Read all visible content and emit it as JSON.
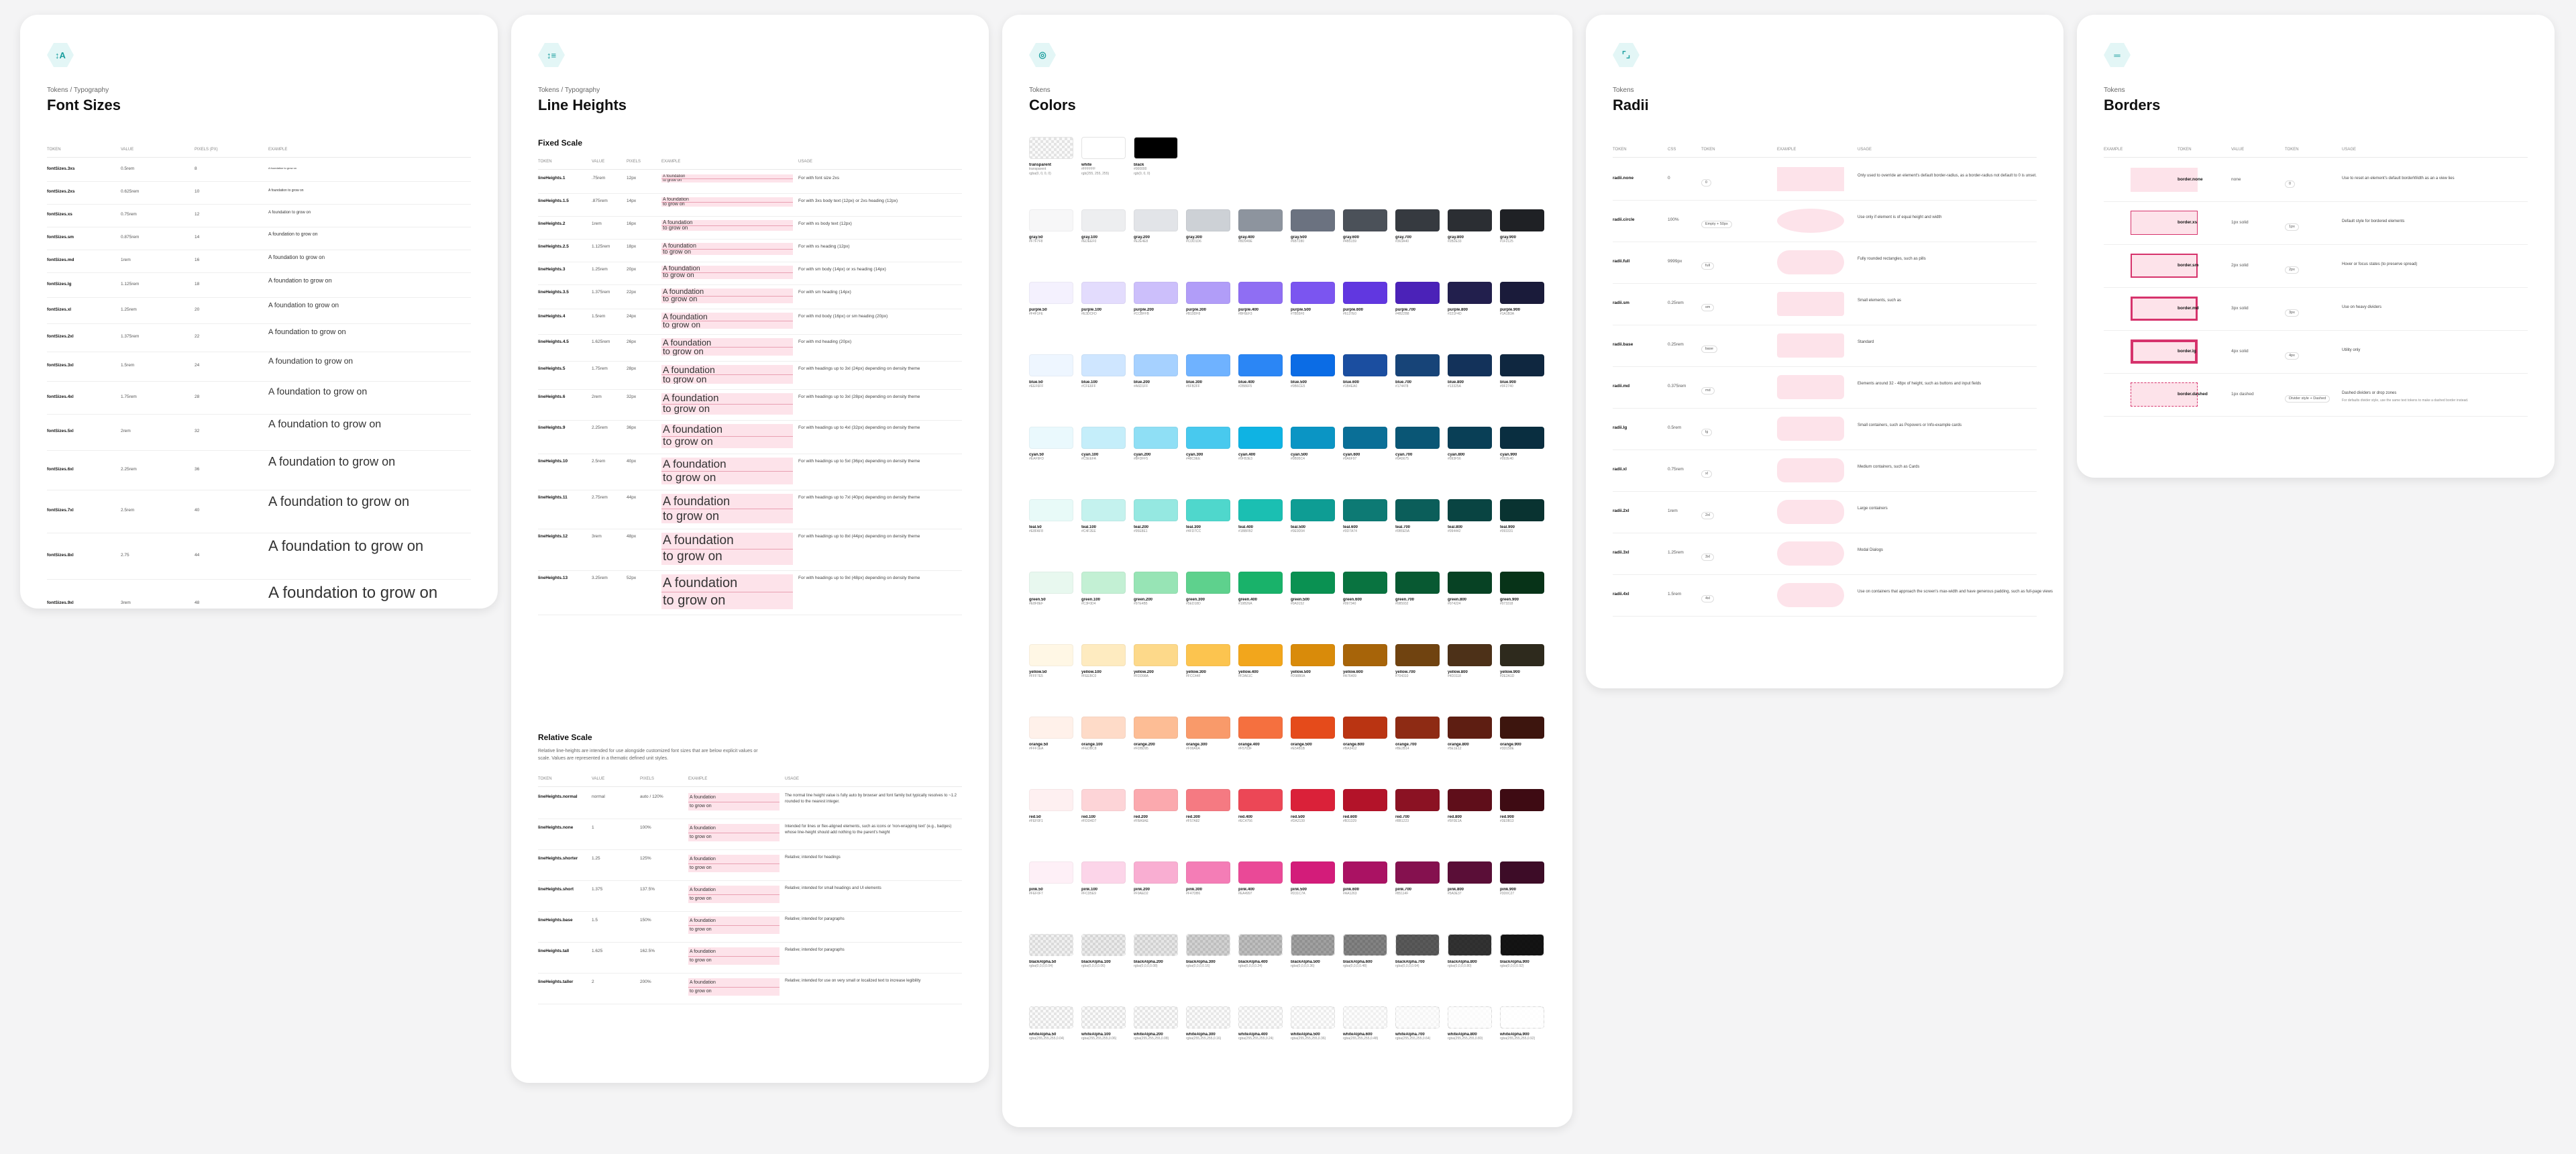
{
  "font_sizes": {
    "icon": "font-size-icon",
    "breadcrumb": "Tokens / Typography",
    "title": "Font Sizes",
    "headers": [
      "TOKEN",
      "VALUE",
      "PIXELS (PX)",
      "EXAMPLE"
    ],
    "example_text": "A foundation to grow on",
    "rows": [
      {
        "token": "fontSizes.3xs",
        "value": "0.5rem",
        "px": "8",
        "size": 8
      },
      {
        "token": "fontSizes.2xs",
        "value": "0.625rem",
        "px": "10",
        "size": 10
      },
      {
        "token": "fontSizes.xs",
        "value": "0.75rem",
        "px": "12",
        "size": 12
      },
      {
        "token": "fontSizes.sm",
        "value": "0.875rem",
        "px": "14",
        "size": 14
      },
      {
        "token": "fontSizes.md",
        "value": "1rem",
        "px": "16",
        "size": 16
      },
      {
        "token": "fontSizes.lg",
        "value": "1.125rem",
        "px": "18",
        "size": 18
      },
      {
        "token": "fontSizes.xl",
        "value": "1.25rem",
        "px": "20",
        "size": 20
      },
      {
        "token": "fontSizes.2xl",
        "value": "1.375rem",
        "px": "22",
        "size": 22
      },
      {
        "token": "fontSizes.3xl",
        "value": "1.5rem",
        "px": "24",
        "size": 24
      },
      {
        "token": "fontSizes.4xl",
        "value": "1.75rem",
        "px": "28",
        "size": 28
      },
      {
        "token": "fontSizes.5xl",
        "value": "2rem",
        "px": "32",
        "size": 32
      },
      {
        "token": "fontSizes.6xl",
        "value": "2.25rem",
        "px": "36",
        "size": 36
      },
      {
        "token": "fontSizes.7xl",
        "value": "2.5rem",
        "px": "40",
        "size": 40
      },
      {
        "token": "fontSizes.8xl",
        "value": "2.75",
        "px": "44",
        "size": 44
      },
      {
        "token": "fontSizes.9xl",
        "value": "3rem",
        "px": "48",
        "size": 48
      }
    ]
  },
  "line_heights": {
    "icon": "line-height-icon",
    "breadcrumb": "Tokens / Typography",
    "title": "Line Heights",
    "fixed_heading": "Fixed Scale",
    "headers": [
      "TOKEN",
      "VALUE",
      "PIXELS",
      "EXAMPLE",
      "USAGE"
    ],
    "example_line1": "A foundation",
    "example_line2": "to grow on",
    "fixed_rows": [
      {
        "token": "lineHeights.1",
        "value": ".75rem",
        "px": "12px",
        "fs": 6,
        "lh": 12,
        "usage": "For with font size 2xs"
      },
      {
        "token": "lineHeights.1.5",
        "value": ".875rem",
        "px": "14px",
        "fs": 7,
        "lh": 14,
        "usage": "For with 3xs body text (12px) or 2xs heading (12px)"
      },
      {
        "token": "lineHeights.2",
        "value": "1rem",
        "px": "16px",
        "fs": 8,
        "lh": 16,
        "usage": "For with xs body text (12px)"
      },
      {
        "token": "lineHeights.2.5",
        "value": "1.125rem",
        "px": "18px",
        "fs": 9,
        "lh": 18,
        "usage": "For with xs heading (12px)"
      },
      {
        "token": "lineHeights.3",
        "value": "1.25rem",
        "px": "20px",
        "fs": 10,
        "lh": 20,
        "usage": "For with sm body (14px) or xs heading (14px)"
      },
      {
        "token": "lineHeights.3.5",
        "value": "1.375rem",
        "px": "22px",
        "fs": 11,
        "lh": 22,
        "usage": "For with sm heading (14px)"
      },
      {
        "token": "lineHeights.4",
        "value": "1.5rem",
        "px": "24px",
        "fs": 12,
        "lh": 24,
        "usage": "For with md body (16px) or sm heading (20px)"
      },
      {
        "token": "lineHeights.4.5",
        "value": "1.625rem",
        "px": "26px",
        "fs": 13,
        "lh": 26,
        "usage": "For with md heading (20px)"
      },
      {
        "token": "lineHeights.5",
        "value": "1.75rem",
        "px": "28px",
        "fs": 14,
        "lh": 28,
        "usage": "For with headings up to 3xl (24px) depending on density theme"
      },
      {
        "token": "lineHeights.6",
        "value": "2rem",
        "px": "32px",
        "fs": 15,
        "lh": 32,
        "usage": "For with headings up to 3xl (28px) depending on density theme"
      },
      {
        "token": "lineHeights.9",
        "value": "2.25rem",
        "px": "36px",
        "fs": 16,
        "lh": 36,
        "usage": "For with headings up to 4xl (32px) depending on density theme"
      },
      {
        "token": "lineHeights.10",
        "value": "2.5rem",
        "px": "40px",
        "fs": 17,
        "lh": 40,
        "usage": "For with headings up to 5xl (36px) depending on density theme"
      },
      {
        "token": "lineHeights.11",
        "value": "2.75rem",
        "px": "44px",
        "fs": 18,
        "lh": 44,
        "usage": "For with headings up to 7xl (40px) depending on density theme"
      },
      {
        "token": "lineHeights.12",
        "value": "3rem",
        "px": "48px",
        "fs": 19,
        "lh": 48,
        "usage": "For with headings up to 8xl (44px) depending on density theme"
      },
      {
        "token": "lineHeights.13",
        "value": "3.25rem",
        "px": "52px",
        "fs": 20,
        "lh": 52,
        "usage": "For with headings up to 9xl (48px) depending on density theme"
      }
    ],
    "relative_heading": "Relative Scale",
    "relative_desc": "Relative line-heights are intended for use alongside customized font sizes that are below explicit values or scale. Values are represented in a thematic defined unit styles.",
    "relative_rows": [
      {
        "token": "lineHeights.normal",
        "value": "normal",
        "px": "auto / 120%",
        "usage": "The normal line height value is fully auto by browser and font family but typically resolves to ~1.2 rounded to the nearest integer."
      },
      {
        "token": "lineHeights.none",
        "value": "1",
        "px": "100%",
        "usage": "Intended for lines or flex-aligned elements, such as icons or 'non-wrapping text' (e.g., badges) whose line-height should add nothing to the parent's height"
      },
      {
        "token": "lineHeights.shorter",
        "value": "1.25",
        "px": "125%",
        "usage": "Relative; intended for headings"
      },
      {
        "token": "lineHeights.short",
        "value": "1.375",
        "px": "137.5%",
        "usage": "Relative; intended for small headings and UI elements"
      },
      {
        "token": "lineHeights.base",
        "value": "1.5",
        "px": "150%",
        "usage": "Relative; intended for paragraphs"
      },
      {
        "token": "lineHeights.tall",
        "value": "1.625",
        "px": "162.5%",
        "usage": "Relative; intended for paragraphs"
      },
      {
        "token": "lineHeights.taller",
        "value": "2",
        "px": "200%",
        "usage": "Relative; intended for use on very small or localized text to increase legibility"
      }
    ]
  },
  "colors": {
    "icon": "palette-icon",
    "breadcrumb": "Tokens",
    "title": "Colors",
    "special": [
      {
        "name": "transparent",
        "sub": "transparent",
        "sub2": "rgba(0, 0, 0, 0)",
        "color": "transparent"
      },
      {
        "name": "white",
        "sub": "#FFFFFF",
        "sub2": "rgb(255, 255, 255)",
        "color": "#FFFFFF"
      },
      {
        "name": "black",
        "sub": "#000000",
        "sub2": "rgb(0, 0, 0)",
        "color": "#000000"
      }
    ],
    "palettes": [
      {
        "name": "gray",
        "colors": [
          "#F7F7F8",
          "#EDEEF0",
          "#E2E4E8",
          "#CDD1D6",
          "#8D949E",
          "#6B7280",
          "#4B5159",
          "#363A40",
          "#2B2E33",
          "#1F2125"
        ]
      },
      {
        "name": "purple",
        "colors": [
          "#F4F1FE",
          "#E3DCFD",
          "#CCBFFB",
          "#B19DF8",
          "#8F6EF3",
          "#7B55F0",
          "#6137E0",
          "#4B22B8",
          "#221F4D",
          "#1A1B3A"
        ]
      },
      {
        "name": "blue",
        "colors": [
          "#EEF6FF",
          "#CFE6FF",
          "#A6D1FF",
          "#6FB2FF",
          "#2B86F5",
          "#0B6CE5",
          "#1B4EA0",
          "#174478",
          "#13325A",
          "#0F2740"
        ]
      },
      {
        "name": "cyan",
        "colors": [
          "#EAF9FD",
          "#C5EEFA",
          "#8FDFF5",
          "#48C9EE",
          "#0FB3E3",
          "#0B95C4",
          "#0A6F97",
          "#0A5675",
          "#093F56",
          "#092E40"
        ]
      },
      {
        "name": "teal",
        "colors": [
          "#E8FAF8",
          "#C4F2EE",
          "#95E8E1",
          "#4FD7CC",
          "#1BBFB2",
          "#0E9D94",
          "#0D7A74",
          "#0B5E5A",
          "#094442",
          "#093331"
        ]
      },
      {
        "name": "green",
        "colors": [
          "#E8F8EF",
          "#C3F0D4",
          "#97E4B5",
          "#5ED18D",
          "#19B26A",
          "#0A9152",
          "#097340",
          "#085932",
          "#074224",
          "#073318"
        ]
      },
      {
        "name": "yellow",
        "colors": [
          "#FFF7E5",
          "#FEEBC0",
          "#FDD98A",
          "#FCC44F",
          "#F2A61C",
          "#D98B0A",
          "#A76409",
          "#704310",
          "#4D3118",
          "#2E2A1D"
        ]
      },
      {
        "name": "orange",
        "colors": [
          "#FFF1EA",
          "#FEDBC8",
          "#FDBD95",
          "#F99A6A",
          "#F5703F",
          "#E54B1B",
          "#BA3412",
          "#8E2B14",
          "#5E1E12",
          "#3D150E"
        ]
      },
      {
        "name": "red",
        "colors": [
          "#FEF0F1",
          "#FDD4D7",
          "#FBA9AE",
          "#F57A82",
          "#EC4756",
          "#DA2139",
          "#B31329",
          "#8B1223",
          "#5F0E1A",
          "#3E0B13"
        ]
      },
      {
        "name": "pink",
        "colors": [
          "#FEF0F7",
          "#FCD5E9",
          "#F9AED2",
          "#F47DB6",
          "#EA4997",
          "#D31C7A",
          "#AA1263",
          "#85114F",
          "#5A0E37",
          "#3D0C27"
        ]
      },
      {
        "name": "blackAlpha",
        "colors": [
          "rgba(0,0,0,0.04)",
          "rgba(0,0,0,0.06)",
          "rgba(0,0,0,0.08)",
          "rgba(0,0,0,0.16)",
          "rgba(0,0,0,0.24)",
          "rgba(0,0,0,0.36)",
          "rgba(0,0,0,0.48)",
          "rgba(0,0,0,0.64)",
          "rgba(0,0,0,0.80)",
          "rgba(0,0,0,0.92)"
        ]
      },
      {
        "name": "whiteAlpha",
        "colors": [
          "rgba(255,255,255,0.04)",
          "rgba(255,255,255,0.06)",
          "rgba(255,255,255,0.08)",
          "rgba(255,255,255,0.16)",
          "rgba(255,255,255,0.24)",
          "rgba(255,255,255,0.36)",
          "rgba(255,255,255,0.48)",
          "rgba(255,255,255,0.64)",
          "rgba(255,255,255,0.80)",
          "rgba(255,255,255,0.92)"
        ]
      }
    ],
    "steps": [
      "50",
      "100",
      "200",
      "300",
      "400",
      "500",
      "600",
      "700",
      "800",
      "900"
    ]
  },
  "radii": {
    "icon": "radius-icon",
    "breadcrumb": "Tokens",
    "title": "Radii",
    "headers": [
      "TOKEN",
      "CSS",
      "TOKEN",
      "EXAMPLE",
      "USAGE"
    ],
    "rows": [
      {
        "token": "radii.none",
        "css": "0",
        "chip": "0",
        "r": "0",
        "usage": "Only used to override an element's default border-radius, as a border-radius not default to 0 is unset."
      },
      {
        "token": "radii.circle",
        "css": "100%",
        "chip": "Empty + 50px",
        "r": "50%",
        "usage": "Use only if element is of equal height and width"
      },
      {
        "token": "radii.full",
        "css": "9999px",
        "chip": "full",
        "r": "18px",
        "usage": "Fully rounded rectangles, such as pills"
      },
      {
        "token": "radii.sm",
        "css": "0.25rem",
        "chip": "sm",
        "r": "4px",
        "usage": "Small elements, such as"
      },
      {
        "token": "radii.base",
        "css": "0.25rem",
        "chip": "base",
        "r": "4px",
        "usage": "Standard"
      },
      {
        "token": "radii.md",
        "css": "0.375rem",
        "chip": "md",
        "r": "6px",
        "usage": "Elements around 32 - 48px of height, such as buttons and input fields"
      },
      {
        "token": "radii.lg",
        "css": "0.5rem",
        "chip": "lg",
        "r": "8px",
        "usage": "Small containers, such as Popovers or Info-example cards"
      },
      {
        "token": "radii.xl",
        "css": "0.75rem",
        "chip": "xl",
        "r": "12px",
        "usage": "Medium containers, such as Cards"
      },
      {
        "token": "radii.2xl",
        "css": "1rem",
        "chip": "2xl",
        "r": "16px",
        "usage": "Large containers"
      },
      {
        "token": "radii.3xl",
        "css": "1.25rem",
        "chip": "3xl",
        "r": "20px",
        "usage": "Modal Dialogs"
      },
      {
        "token": "radii.4xl",
        "css": "1.5rem",
        "chip": "4xl",
        "r": "24px",
        "usage": "Use on containers that approach the screen's max-width and have generous padding, such as full-page views"
      }
    ]
  },
  "borders": {
    "icon": "border-icon",
    "breadcrumb": "Tokens",
    "title": "Borders",
    "headers": [
      "EXAMPLE",
      "TOKEN",
      "VALUE",
      "TOKEN",
      "USAGE"
    ],
    "rows": [
      {
        "token": "border.none",
        "value": "none",
        "chip": "0",
        "style": "none",
        "usage": "Use to reset an element's default borderWidth as an a view lies"
      },
      {
        "token": "border.xs",
        "value": "1px solid",
        "chip": "1px",
        "style": "1px solid",
        "usage": "Default style for bordered elements"
      },
      {
        "token": "border.sm",
        "value": "2px solid",
        "chip": "2px",
        "style": "2px solid",
        "usage": "Hover or focus states (to preserve spread)"
      },
      {
        "token": "border.md",
        "value": "3px solid",
        "chip": "3px",
        "style": "3px solid",
        "usage": "Use on heavy dividers"
      },
      {
        "token": "border.lg",
        "value": "4px solid",
        "chip": "4px",
        "style": "4px solid",
        "usage": "Utility only"
      },
      {
        "token": "border.dashed",
        "value": "1px dashed",
        "chip": "Divider style + Dashed",
        "style": "1px dashed",
        "usage": "Dashed dividers or drop zones"
      }
    ],
    "dashed_note": "For defaults divider style, use the same text tokens to make a dashed border instead."
  }
}
